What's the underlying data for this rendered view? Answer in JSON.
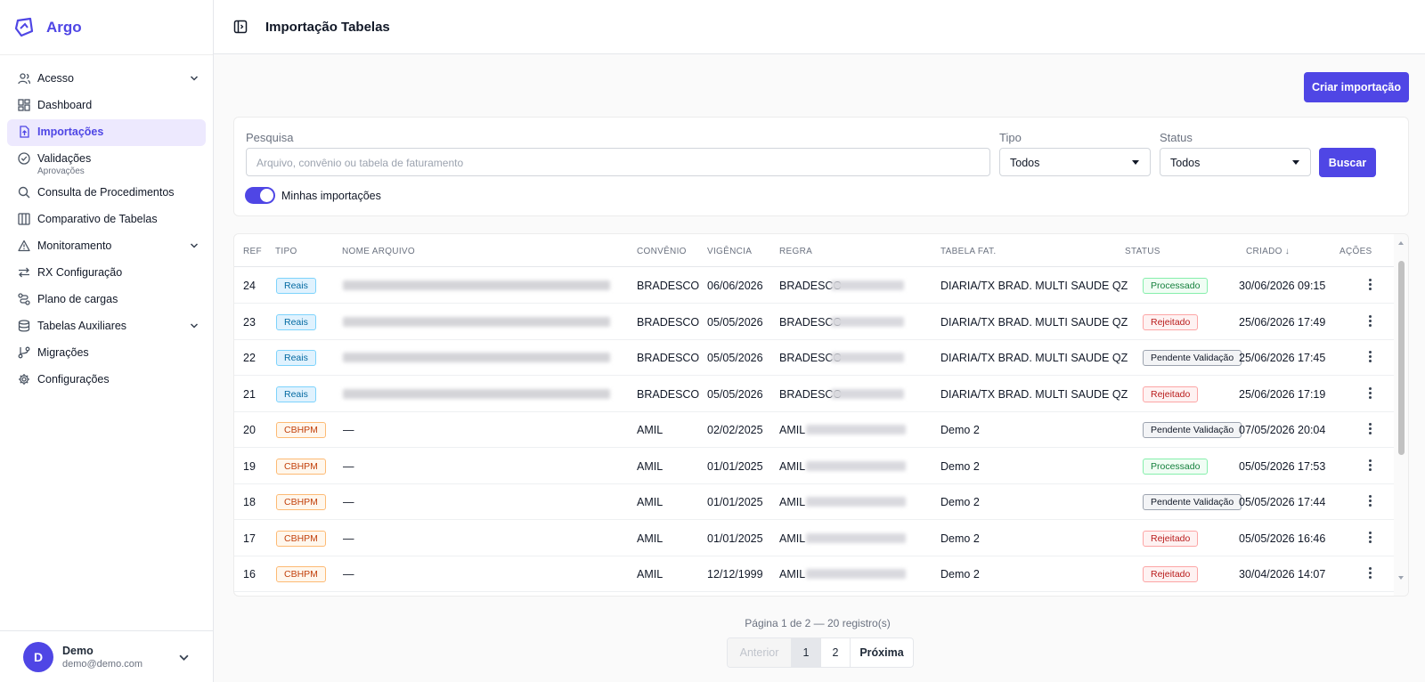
{
  "app": {
    "name": "Argo",
    "page_title": "Importação Tabelas"
  },
  "sidebar": {
    "items": [
      {
        "label": "Acesso",
        "icon": "users-icon",
        "chevron": true
      },
      {
        "label": "Dashboard",
        "icon": "dashboard-icon"
      },
      {
        "label": "Importações",
        "icon": "file-upload-icon",
        "active": true
      },
      {
        "label": "Validações",
        "sub": "Aprovações",
        "icon": "check-circle-icon"
      },
      {
        "label": "Consulta de Procedimentos",
        "icon": "search-icon"
      },
      {
        "label": "Comparativo de Tabelas",
        "icon": "columns-icon"
      },
      {
        "label": "Monitoramento",
        "icon": "alert-triangle-icon",
        "chevron": true
      },
      {
        "label": "RX Configuração",
        "icon": "swap-icon"
      },
      {
        "label": "Plano de cargas",
        "icon": "route-icon"
      },
      {
        "label": "Tabelas Auxiliares",
        "icon": "database-icon",
        "chevron": true
      },
      {
        "label": "Migrações",
        "icon": "git-branch-icon"
      },
      {
        "label": "Configurações",
        "icon": "gear-icon"
      }
    ]
  },
  "user": {
    "initial": "D",
    "name": "Demo",
    "email": "demo@demo.com"
  },
  "actions": {
    "create_label": "Criar importação"
  },
  "filters": {
    "search_label": "Pesquisa",
    "search_placeholder": "Arquivo, convênio ou tabela de faturamento",
    "tipo_label": "Tipo",
    "tipo_value": "Todos",
    "status_label": "Status",
    "status_value": "Todos",
    "search_button": "Buscar",
    "toggle_label": "Minhas importações",
    "toggle_on": true
  },
  "table": {
    "columns": [
      "REF",
      "TIPO",
      "NOME ARQUIVO",
      "CONVÊNIO",
      "VIGÊNCIA",
      "REGRA",
      "TABELA FAT.",
      "STATUS",
      "CRIADO ↓",
      "AÇÕES"
    ],
    "rows": [
      {
        "ref": "24",
        "tipo": "Reais",
        "arquivo": "",
        "convenio": "BRADESCO",
        "vigencia": "06/06/2026",
        "regra": "BRADESCO",
        "tabela": "DIARIA/TX BRAD. MULTI SAUDE QZ",
        "status": "Processado",
        "criado": "30/06/2026 09:15"
      },
      {
        "ref": "23",
        "tipo": "Reais",
        "arquivo": "",
        "convenio": "BRADESCO",
        "vigencia": "05/05/2026",
        "regra": "BRADESCO",
        "tabela": "DIARIA/TX BRAD. MULTI SAUDE QZ",
        "status": "Rejeitado",
        "criado": "25/06/2026 17:49"
      },
      {
        "ref": "22",
        "tipo": "Reais",
        "arquivo": "",
        "convenio": "BRADESCO",
        "vigencia": "05/05/2026",
        "regra": "BRADESCO",
        "tabela": "DIARIA/TX BRAD. MULTI SAUDE QZ",
        "status": "Pendente Validação",
        "criado": "25/06/2026 17:45"
      },
      {
        "ref": "21",
        "tipo": "Reais",
        "arquivo": "",
        "convenio": "BRADESCO",
        "vigencia": "05/05/2026",
        "regra": "BRADESCO",
        "tabela": "DIARIA/TX BRAD. MULTI SAUDE QZ",
        "status": "Rejeitado",
        "criado": "25/06/2026 17:19"
      },
      {
        "ref": "20",
        "tipo": "CBHPM",
        "arquivo": "—",
        "convenio": "AMIL",
        "vigencia": "02/02/2025",
        "regra": "AMIL",
        "tabela": "Demo 2",
        "status": "Pendente Validação",
        "criado": "07/05/2026 20:04"
      },
      {
        "ref": "19",
        "tipo": "CBHPM",
        "arquivo": "—",
        "convenio": "AMIL",
        "vigencia": "01/01/2025",
        "regra": "AMIL",
        "tabela": "Demo 2",
        "status": "Processado",
        "criado": "05/05/2026 17:53"
      },
      {
        "ref": "18",
        "tipo": "CBHPM",
        "arquivo": "—",
        "convenio": "AMIL",
        "vigencia": "01/01/2025",
        "regra": "AMIL",
        "tabela": "Demo 2",
        "status": "Pendente Validação",
        "criado": "05/05/2026 17:44"
      },
      {
        "ref": "17",
        "tipo": "CBHPM",
        "arquivo": "—",
        "convenio": "AMIL",
        "vigencia": "01/01/2025",
        "regra": "AMIL",
        "tabela": "Demo 2",
        "status": "Rejeitado",
        "criado": "05/05/2026 16:46"
      },
      {
        "ref": "16",
        "tipo": "CBHPM",
        "arquivo": "—",
        "convenio": "AMIL",
        "vigencia": "12/12/1999",
        "regra": "AMIL",
        "tabela": "Demo 2",
        "status": "Rejeitado",
        "criado": "30/04/2026 14:07"
      }
    ]
  },
  "pagination": {
    "info": "Página 1 de 2 — 20 registro(s)",
    "prev_label": "Anterior",
    "pages": [
      "1",
      "2"
    ],
    "current": "1",
    "next_label": "Próxima"
  },
  "colors": {
    "accent": "#4f46e5",
    "active_bg": "#ede9fe"
  }
}
